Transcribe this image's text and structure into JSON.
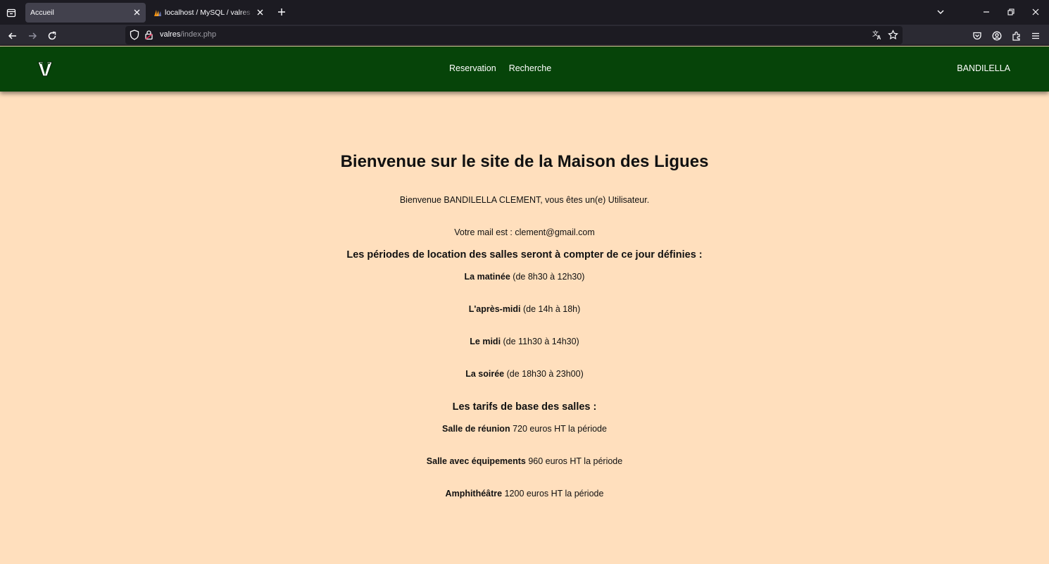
{
  "browser": {
    "tabs": [
      {
        "title": "Accueil",
        "active": true
      },
      {
        "title": "localhost / MySQL / valres / utilisateur",
        "active": false
      }
    ],
    "url": {
      "host": "valres",
      "path": "/index.php"
    },
    "icons": {
      "tab_list": "tab-list-icon",
      "close": "close-icon",
      "new_tab": "plus-icon",
      "back": "back-arrow-icon",
      "forward": "forward-arrow-icon",
      "reload": "reload-icon",
      "shield": "shield-icon",
      "lock": "lock-icon",
      "translate": "translate-icon",
      "bookmark": "star-icon",
      "pocket": "pocket-icon",
      "account": "account-icon",
      "extensions": "extensions-icon",
      "menu": "hamburger-menu-icon"
    }
  },
  "site": {
    "colors": {
      "header": "#064409",
      "background": "#ffdfbd"
    },
    "nav": {
      "reservation": "Reservation",
      "recherche": "Recherche"
    },
    "user": "BANDILELLA"
  },
  "main": {
    "title": "Bienvenue sur le site de la Maison des Ligues",
    "welcome": "Bienvenue BANDILELLA CLEMENT, vous êtes un(e) Utilisateur.",
    "mail": "Votre mail est : clement@gmail.com",
    "periods_heading": "Les périodes de location des salles seront à compter de ce jour définies :",
    "periods": [
      {
        "name": "La matinée",
        "detail": " (de 8h30 à 12h30)"
      },
      {
        "name": "L'après-midi",
        "detail": " (de 14h à 18h)"
      },
      {
        "name": "Le midi",
        "detail": " (de 11h30 à 14h30)"
      },
      {
        "name": "La soirée",
        "detail": " (de 18h30 à 23h00)"
      }
    ],
    "prices_heading": "Les tarifs de base des salles :",
    "prices": [
      {
        "name": "Salle de réunion",
        "detail": " 720 euros HT la période"
      },
      {
        "name": "Salle avec équipements",
        "detail": " 960 euros HT la période"
      },
      {
        "name": "Amphithéâtre",
        "detail": " 1200 euros HT la période"
      }
    ]
  }
}
